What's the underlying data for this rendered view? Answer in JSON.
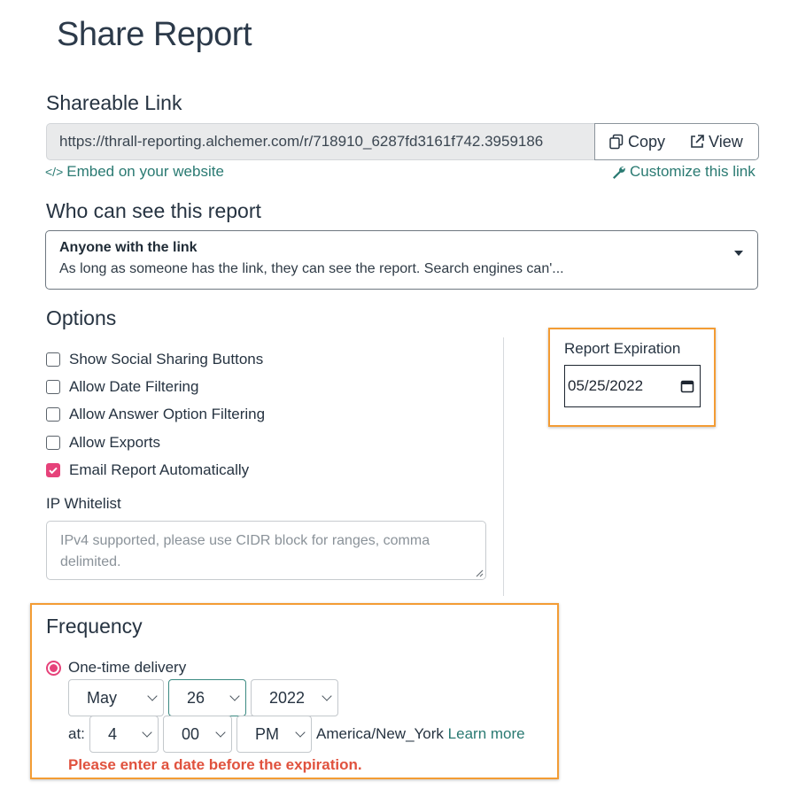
{
  "page_title": "Share Report",
  "shareable_link": {
    "title": "Shareable Link",
    "url": "https://thrall-reporting.alchemer.com/r/718910_6287fd3161f742.3959186",
    "copy_label": "Copy",
    "view_label": "View",
    "embed_label": "Embed on your website",
    "customize_label": "Customize this link"
  },
  "visibility": {
    "title": "Who can see this report",
    "selected_title": "Anyone with the link",
    "selected_desc": "As long as someone has the link, they can see the report. Search engines can'..."
  },
  "options": {
    "title": "Options",
    "checkboxes": [
      {
        "label": "Show Social Sharing Buttons",
        "checked": false
      },
      {
        "label": "Allow Date Filtering",
        "checked": false
      },
      {
        "label": "Allow Answer Option Filtering",
        "checked": false
      },
      {
        "label": "Allow Exports",
        "checked": false
      },
      {
        "label": "Email Report Automatically",
        "checked": true
      }
    ],
    "ip_whitelist_label": "IP Whitelist",
    "ip_whitelist_placeholder": "IPv4 supported, please use CIDR block for ranges, comma delimited."
  },
  "expiration": {
    "label": "Report Expiration",
    "value": "05/25/2022"
  },
  "frequency": {
    "title": "Frequency",
    "option_label": "One-time delivery",
    "month": "May",
    "day": "26",
    "year": "2022",
    "at_label": "at:",
    "hour": "4",
    "minute": "00",
    "ampm": "PM",
    "timezone": "America/New_York",
    "learn_more": "Learn more",
    "error": "Please enter a date before the expiration."
  },
  "colors": {
    "accent_pink": "#e6427a",
    "link_teal": "#2a7a72",
    "highlight_orange": "#f39c34",
    "error_red": "#e0523e"
  }
}
